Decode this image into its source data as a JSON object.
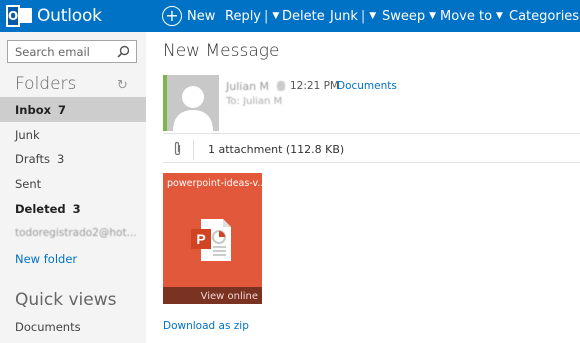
{
  "app": {
    "title": "Outlook"
  },
  "toolbar": {
    "new_label": "New",
    "reply_label": "Reply",
    "delete_label": "Delete",
    "junk_label": "Junk",
    "sweep_label": "Sweep",
    "moveto_label": "Move to",
    "categories_label": "Categories"
  },
  "search": {
    "placeholder": "Search email"
  },
  "sidebar": {
    "folders_title": "Folders",
    "folders": [
      {
        "label": "Inbox",
        "count": "7"
      },
      {
        "label": "Junk",
        "count": ""
      },
      {
        "label": "Drafts",
        "count": "3"
      },
      {
        "label": "Sent",
        "count": ""
      },
      {
        "label": "Deleted",
        "count": "3"
      },
      {
        "label": "todoregistrado2@hot...",
        "count": ""
      }
    ],
    "new_folder": "New folder",
    "quick_views_title": "Quick views",
    "quick_views": [
      {
        "label": "Documents"
      }
    ]
  },
  "message": {
    "title": "New Message",
    "sender": "Julian M",
    "time": "12:21 PM",
    "folder_link": "Documents",
    "to_line": "To: Julian M",
    "attachment_summary": "1 attachment (112.8 KB)",
    "attachment": {
      "name": "powerpoint-ideas-v...",
      "view_label": "View online"
    },
    "download_label": "Download as zip"
  },
  "colors": {
    "accent": "#0072c6",
    "tile": "#e1583a",
    "avatar_bar": "#7ab648"
  }
}
